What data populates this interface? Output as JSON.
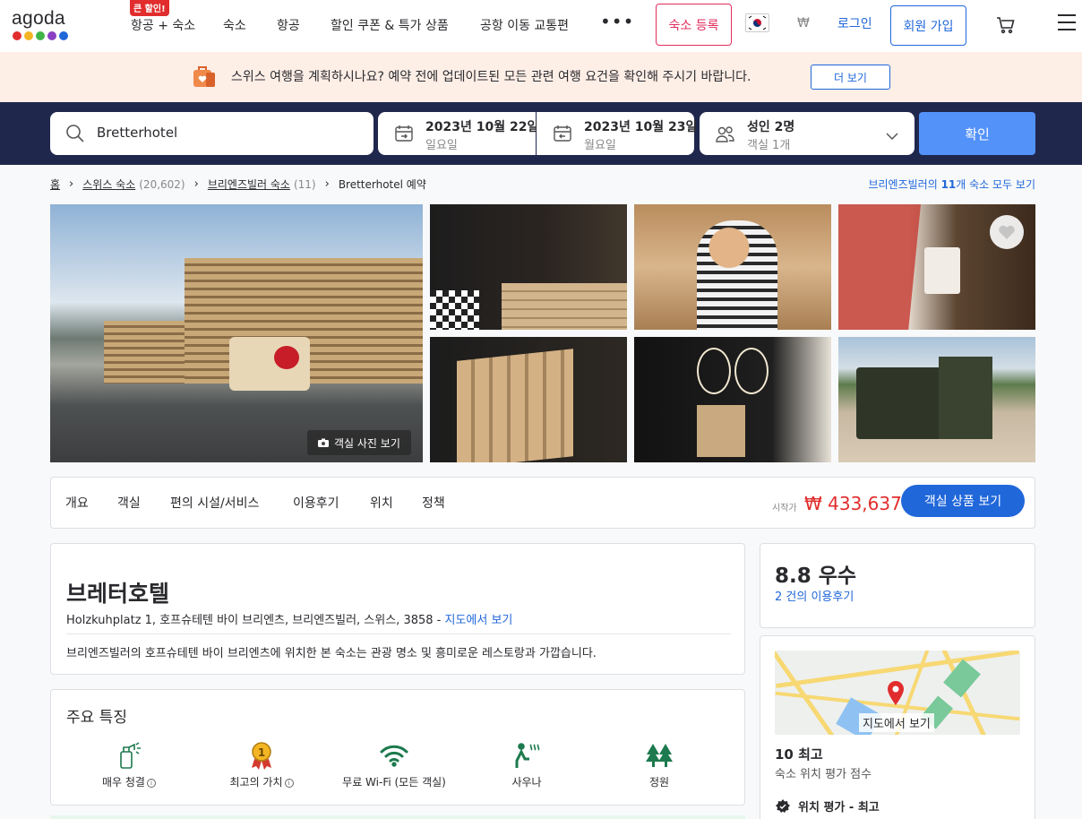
{
  "brand": {
    "logo_text": "agoda",
    "dot_colors": [
      "#e12d2d",
      "#f4b524",
      "#3fb548",
      "#8940c2",
      "#2067da"
    ]
  },
  "nav": {
    "promo_badge": "큰 할인!",
    "items": [
      "항공 + 숙소",
      "숙소",
      "항공",
      "할인 쿠폰 & 특가 상품",
      "공항 이동 교통편"
    ],
    "more": "•••",
    "register": "숙소 등록",
    "currency": "₩",
    "login": "로그인",
    "signup": "회원 가입"
  },
  "banner": {
    "text": "스위스 여행을 계획하시나요? 예약 전에 업데이트된 모든 관련 여행 요건을 확인해 주시기 바랍니다.",
    "button": "더 보기"
  },
  "search": {
    "query": "Bretterhotel",
    "checkin_date": "2023년 10월 22일",
    "checkin_day": "일요일",
    "checkout_date": "2023년 10월 23일",
    "checkout_day": "월요일",
    "guests": "성인 2명",
    "rooms": "객실 1개",
    "confirm": "확인"
  },
  "breadcrumb": {
    "home": "홈",
    "country": "스위스 숙소",
    "country_count": "(20,602)",
    "city": "브리엔즈빌러 숙소",
    "city_count": "(11)",
    "current": "Bretterhotel 예약"
  },
  "see_all": {
    "prefix": "브리엔즈빌러의 ",
    "count": "11",
    "suffix": "개 숙소 모두 보기"
  },
  "gallery": {
    "room_photos": "객실 사진 보기"
  },
  "tabs": [
    "개요",
    "객실",
    "편의 시설/서비스",
    "이용후기",
    "위치",
    "정책"
  ],
  "price": {
    "label": "시작가",
    "value": "₩ 433,637",
    "button": "객실 상품 보기"
  },
  "hotel": {
    "name": "브레터호텔",
    "address": "Holzkuhplatz 1, 호프슈테텐 바이 브리엔츠, 브리엔즈빌러, 스위스, 3858 - ",
    "map_link": "지도에서 보기",
    "description": "브리엔즈빌러의 호프슈테텐 바이 브리엔츠에 위치한 본 숙소는 관광 명소 및 흥미로운 레스토랑과 가깝습니다."
  },
  "features": {
    "title": "주요 특징",
    "items": [
      {
        "label": "매우 청결",
        "icon": "cleaning-spray-icon",
        "info": true
      },
      {
        "label": "최고의 가치",
        "icon": "medal-icon",
        "info": true
      },
      {
        "label": "무료 Wi-Fi (모든 객실)",
        "icon": "wifi-icon",
        "info": false
      },
      {
        "label": "사우나",
        "icon": "sauna-icon",
        "info": false
      },
      {
        "label": "정원",
        "icon": "trees-icon",
        "info": false
      }
    ]
  },
  "rating": {
    "score": "8.8 우수",
    "reviews": "2 건의 이용후기"
  },
  "location": {
    "map_label": "지도에서 보기",
    "score": "10 최고",
    "score_label": "숙소 위치 평가 점수",
    "badge": "위치 평가 - 최고"
  },
  "colors": {
    "brand_blue": "#2067da",
    "search_bg": "#20274d",
    "confirm_btn": "#5392f9",
    "price_red": "#e12d2d",
    "banner_bg": "#fdeee6",
    "feature_green": "#1d7a4e"
  }
}
